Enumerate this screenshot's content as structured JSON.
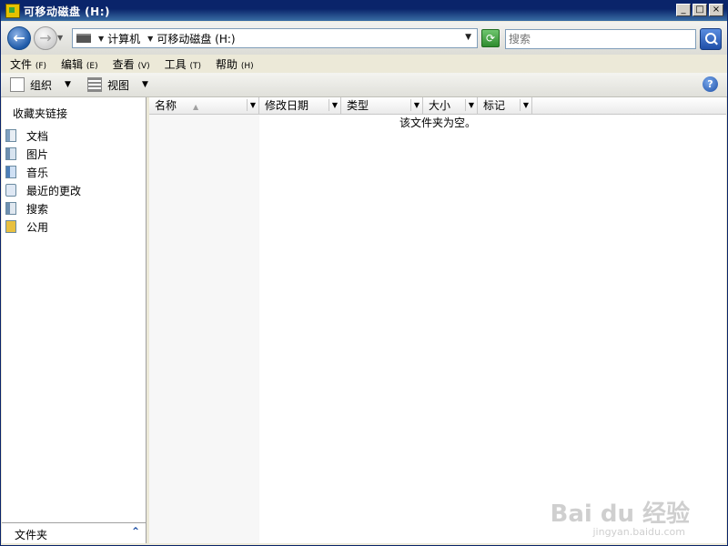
{
  "window": {
    "title": "可移动磁盘 (H:)"
  },
  "address": {
    "crumbs": [
      "计算机",
      "可移动磁盘 (H:)"
    ],
    "search_placeholder": "搜索"
  },
  "menu": {
    "items": [
      {
        "label": "文件",
        "accel": "(F)"
      },
      {
        "label": "编辑",
        "accel": "(E)"
      },
      {
        "label": "查看",
        "accel": "(V)"
      },
      {
        "label": "工具",
        "accel": "(T)"
      },
      {
        "label": "帮助",
        "accel": "(H)"
      }
    ]
  },
  "toolbar": {
    "organize_label": "组织",
    "views_label": "视图"
  },
  "nav": {
    "favorites_title": "收藏夹链接",
    "items": [
      {
        "label": "文档",
        "icon": "documents-icon"
      },
      {
        "label": "图片",
        "icon": "pictures-icon"
      },
      {
        "label": "音乐",
        "icon": "music-icon"
      },
      {
        "label": "最近的更改",
        "icon": "recent-changes-icon"
      },
      {
        "label": "搜索",
        "icon": "searches-icon"
      },
      {
        "label": "公用",
        "icon": "public-folder-icon"
      }
    ],
    "folders_label": "文件夹"
  },
  "content": {
    "columns": [
      "名称",
      "修改日期",
      "类型",
      "大小",
      "标记"
    ],
    "empty_message": "该文件夹为空。"
  },
  "watermark": {
    "logo_text": "Bai du 经验",
    "url_text": "jingyan.baidu.com"
  }
}
